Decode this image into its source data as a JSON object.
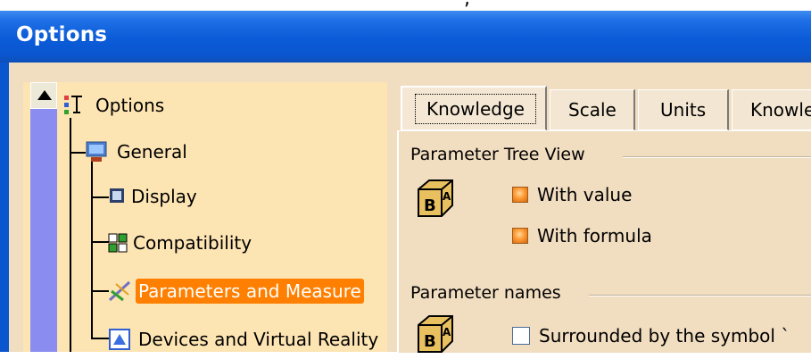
{
  "window": {
    "title": "Options"
  },
  "top_strip": {
    "text": ", "
  },
  "tree": {
    "items": [
      {
        "label": "Options"
      },
      {
        "label": "General"
      },
      {
        "label": "Display"
      },
      {
        "label": "Compatibility"
      },
      {
        "label": "Parameters and Measure"
      },
      {
        "label": "Devices and Virtual Reality"
      }
    ]
  },
  "tabs": [
    {
      "label": "Knowledge"
    },
    {
      "label": "Scale"
    },
    {
      "label": "Units"
    },
    {
      "label": "Knowle"
    }
  ],
  "panel": {
    "group1": {
      "title": "Parameter Tree View",
      "options": [
        {
          "label": "With value",
          "checked": true
        },
        {
          "label": "With formula",
          "checked": true
        }
      ]
    },
    "group2": {
      "title": "Parameter names",
      "options": [
        {
          "label": "Surrounded by the symbol `",
          "checked": false
        }
      ]
    }
  },
  "colors": {
    "titlebar": "#0a56cf",
    "selection": "#ff7f00",
    "tree_bg": "#fde4b3",
    "scrollbar": "#8a8cf0"
  }
}
